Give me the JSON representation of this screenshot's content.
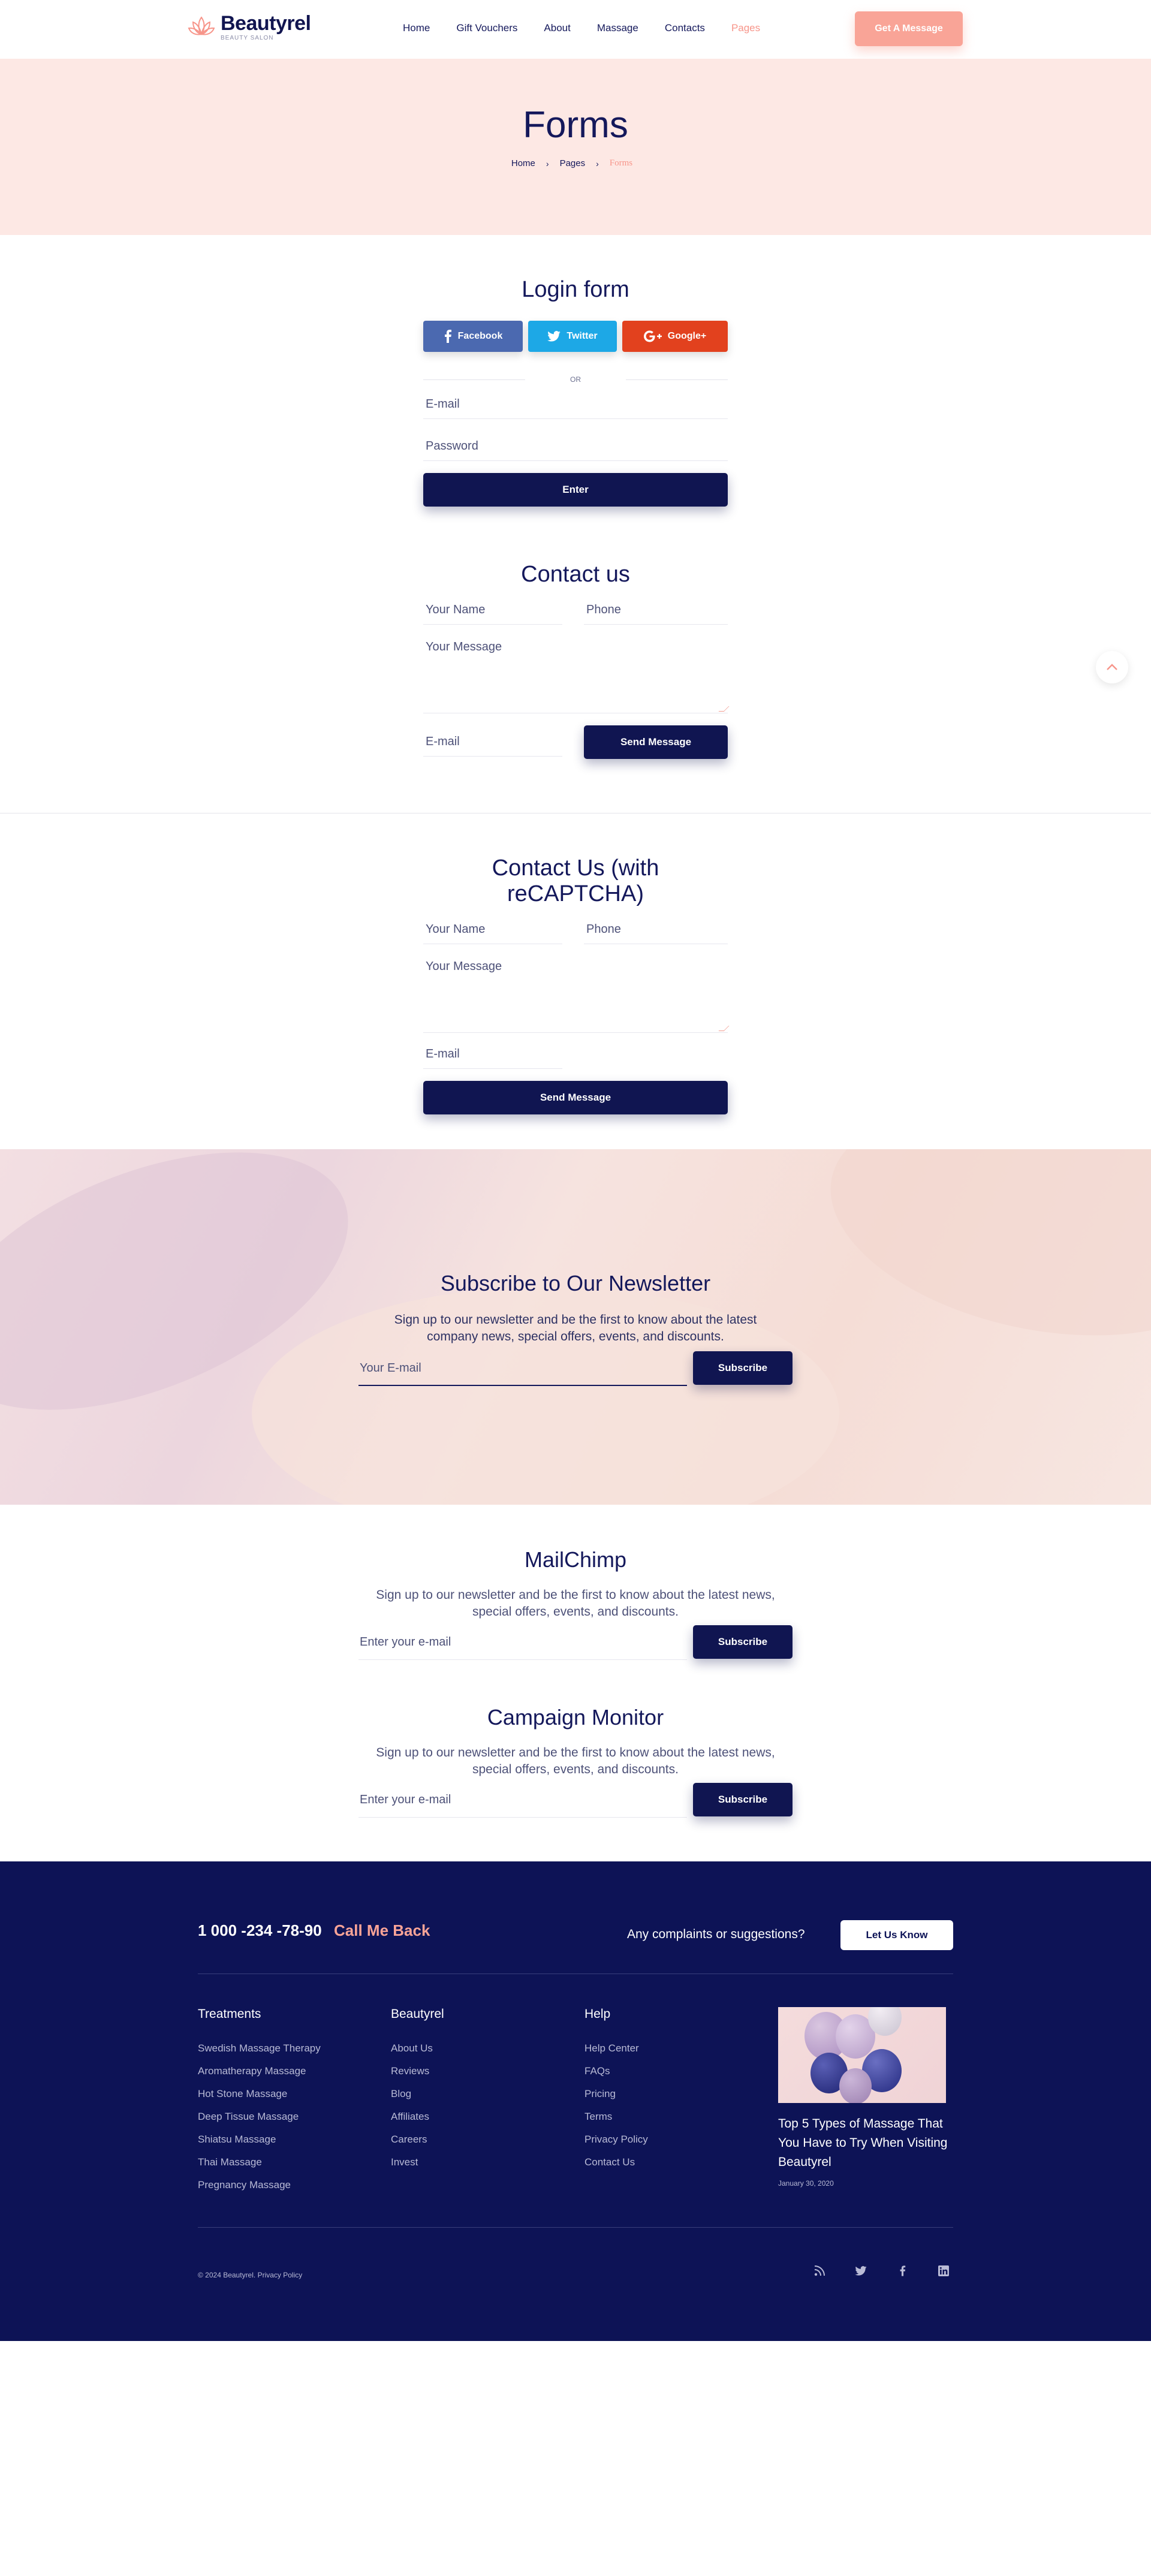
{
  "header": {
    "logo_name": "Beautyrel",
    "logo_sub": "BEAUTY SALON",
    "nav": [
      {
        "label": "Home",
        "active": false
      },
      {
        "label": "Gift Vouchers",
        "active": false
      },
      {
        "label": "About",
        "active": false
      },
      {
        "label": "Massage",
        "active": false
      },
      {
        "label": "Contacts",
        "active": false
      },
      {
        "label": "Pages",
        "active": true
      }
    ],
    "cta_label": "Get A Message"
  },
  "hero": {
    "title": "Forms",
    "breadcrumb": [
      "Home",
      "Pages",
      "Forms"
    ]
  },
  "login": {
    "title": "Login form",
    "facebook": "Facebook",
    "twitter": "Twitter",
    "google": "Google+",
    "or": "OR",
    "email_placeholder": "E-mail",
    "password_placeholder": "Password",
    "submit": "Enter"
  },
  "contact": {
    "title": "Contact us",
    "name_placeholder": "Your Name",
    "phone_placeholder": "Phone",
    "message_placeholder": "Your Message",
    "email_placeholder": "E-mail",
    "submit": "Send Message"
  },
  "contact_captcha": {
    "title": "Contact Us (with reCAPTCHA)",
    "name_placeholder": "Your Name",
    "phone_placeholder": "Phone",
    "message_placeholder": "Your Message",
    "email_placeholder": "E-mail",
    "submit": "Send Message"
  },
  "newsletter": {
    "title": "Subscribe to Our Newsletter",
    "text": "Sign up to our newsletter and be the first to know about the latest company news, special offers, events, and discounts.",
    "email_placeholder": "Your E-mail",
    "submit": "Subscribe"
  },
  "mailchimp": {
    "title": "MailChimp",
    "text": "Sign up to our newsletter and be the first to know about the latest news, special offers, events, and discounts.",
    "email_placeholder": "Enter your e-mail",
    "submit": "Subscribe"
  },
  "campaign": {
    "title": "Campaign Monitor",
    "text": "Sign up to our newsletter and be the first to know about the latest news, special offers, events, and discounts.",
    "email_placeholder": "Enter your e-mail",
    "submit": "Subscribe"
  },
  "footer": {
    "phone": "1 000 -234 -78-90",
    "call_back": "Call Me Back",
    "complaints": "Any complaints or suggestions?",
    "let_us_know": "Let Us Know",
    "columns": [
      {
        "title": "Treatments",
        "items": [
          "Swedish Massage Therapy",
          "Aromatherapy Massage",
          "Hot Stone Massage",
          "Deep Tissue Massage",
          "Shiatsu Massage",
          "Thai Massage",
          "Pregnancy Massage"
        ]
      },
      {
        "title": "Beautyrel",
        "items": [
          "About Us",
          "Reviews",
          "Blog",
          "Affiliates",
          "Careers",
          "Invest"
        ]
      },
      {
        "title": "Help",
        "items": [
          "Help Center",
          "FAQs",
          "Pricing",
          "Terms",
          "Privacy Policy",
          "Contact Us"
        ]
      }
    ],
    "news_title": "Top 5 Types of Massage That You Have to Try When Visiting Beautyrel",
    "news_date": "January 30, 2020",
    "copyright": "©  2024 Beautyrel. Privacy Policy",
    "social_icons": [
      "rss-icon",
      "twitter-icon",
      "facebook-icon",
      "linkedin-icon"
    ]
  },
  "colors": {
    "navy": "#14185b",
    "accent": "#f9a497",
    "hero_bg": "#fde8e4",
    "footer_bg": "#0d1356"
  }
}
